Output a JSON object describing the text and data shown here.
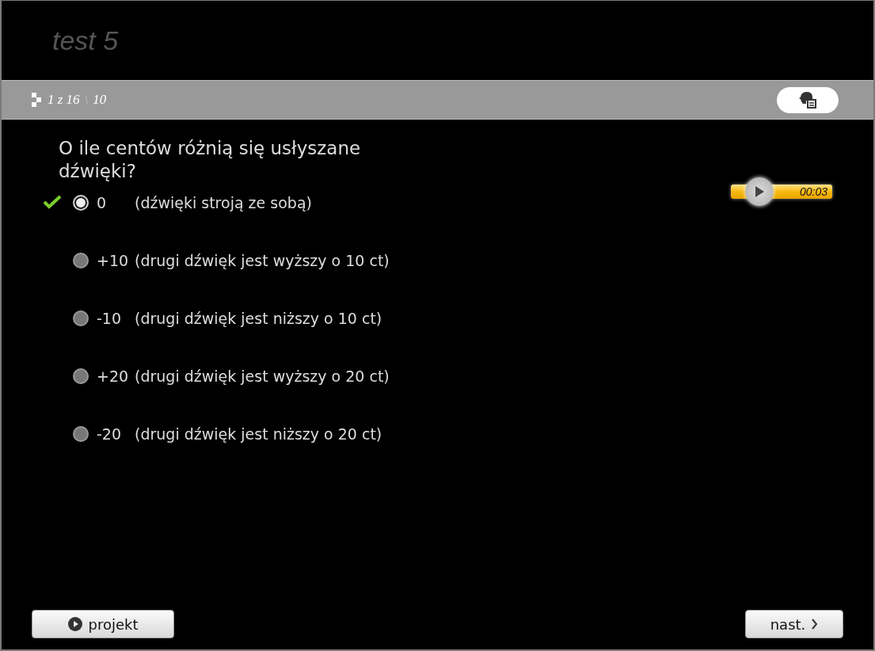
{
  "title": "test 5",
  "progress": {
    "current": "1 z 16",
    "separator": "\\",
    "score": "10"
  },
  "question": "O ile centów różnią się usłyszane dźwięki?",
  "player": {
    "time": "00:03"
  },
  "options": [
    {
      "value": "0",
      "text": "(dźwięki stroją ze sobą)",
      "correct": true,
      "selected": true
    },
    {
      "value": "+10",
      "text": "(drugi dźwięk jest wyższy o 10 ct)",
      "correct": false,
      "selected": false
    },
    {
      "value": "-10",
      "text": "(drugi dźwięk jest niższy o 10 ct)",
      "correct": false,
      "selected": false
    },
    {
      "value": "+20",
      "text": "(drugi dźwięk jest wyższy o 20 ct)",
      "correct": false,
      "selected": false
    },
    {
      "value": "-20",
      "text": "(drugi dźwięk jest niższy o 20 ct)",
      "correct": false,
      "selected": false
    }
  ],
  "buttons": {
    "back": "projekt",
    "next": "nast."
  }
}
